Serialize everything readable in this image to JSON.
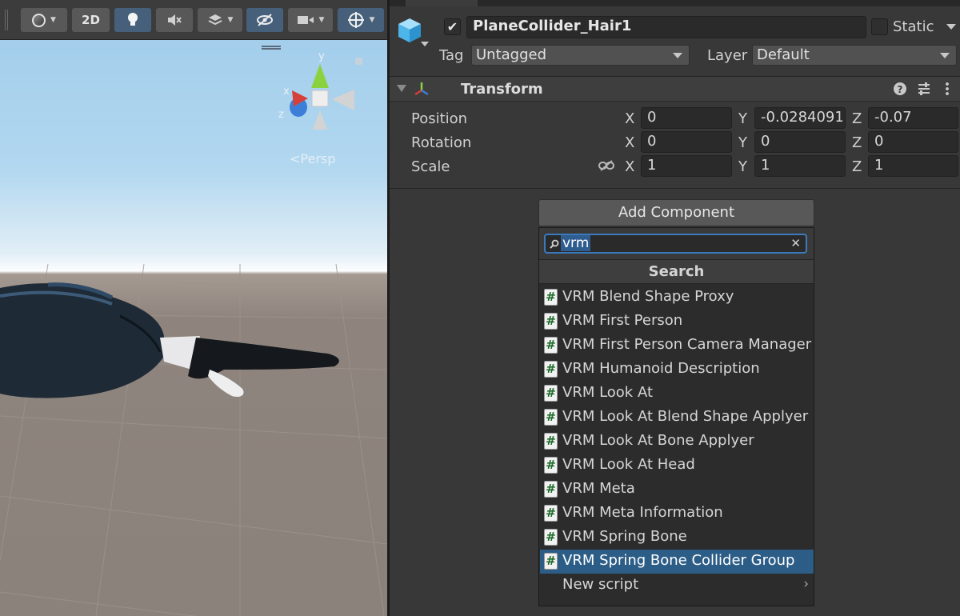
{
  "scene": {
    "toolbar": {
      "shading_icon": "shading-mode-sphere-icon",
      "btn_2d": "2D",
      "lighting_icon": "lightbulb-icon",
      "audio_icon": "audio-muted-icon",
      "effects_icon": "effects-layers-icon",
      "visibility_icon": "scene-visibility-icon",
      "camera_icon": "scene-camera-icon",
      "gizmos_icon": "gizmos-icon"
    },
    "gizmo": {
      "axis_y": "y",
      "axis_x": "x",
      "axis_z": "z",
      "projection": "Persp"
    },
    "colors": {
      "axis_x": "#d6403a",
      "axis_y": "#8bd240",
      "axis_z": "#3d7fd8"
    }
  },
  "inspector": {
    "object": {
      "icon": "cube-icon",
      "active_checked": true,
      "name": "PlaneCollider_Hair1",
      "static_label": "Static",
      "tag_label": "Tag",
      "tag_value": "Untagged",
      "layer_label": "Layer",
      "layer_value": "Default"
    },
    "transform": {
      "title": "Transform",
      "rows": [
        {
          "label": "Position",
          "x": "0",
          "y": "-0.0284091",
          "z": "-0.07"
        },
        {
          "label": "Rotation",
          "x": "0",
          "y": "0",
          "z": "0"
        },
        {
          "label": "Scale",
          "x": "1",
          "y": "1",
          "z": "1"
        }
      ],
      "axis_x": "X",
      "axis_y": "Y",
      "axis_z": "Z"
    },
    "add_component": {
      "button_label": "Add Component",
      "search_value": "vrm",
      "header": "Search",
      "items": [
        "VRM Blend Shape Proxy",
        "VRM First Person",
        "VRM First Person Camera Manager",
        "VRM Humanoid Description",
        "VRM Look At",
        "VRM Look At Blend Shape Applyer",
        "VRM Look At Bone Applyer",
        "VRM Look At Head",
        "VRM Meta",
        "VRM Meta Information",
        "VRM Spring Bone",
        "VRM Spring Bone Collider Group"
      ],
      "selected_item": "VRM Spring Bone Collider Group",
      "new_script": "New script",
      "script_icon_glyph": "#"
    }
  }
}
